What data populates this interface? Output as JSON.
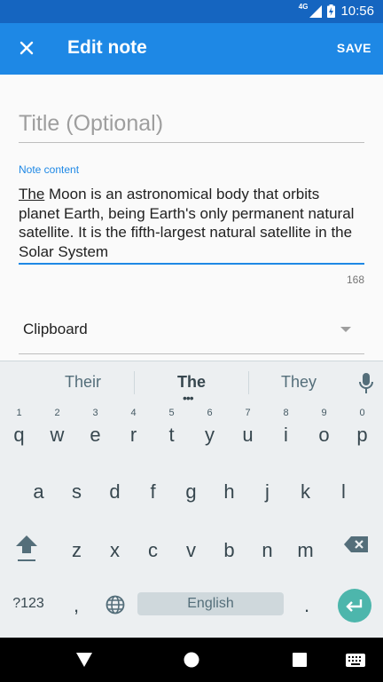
{
  "status_bar": {
    "network": "4G",
    "time": "10:56"
  },
  "app_bar": {
    "close_icon": "close-icon",
    "title": "Edit note",
    "save_label": "SAVE"
  },
  "form": {
    "title_placeholder": "Title (Optional)",
    "note_label": "Note content",
    "note_first_word": "The",
    "note_rest": " Moon is an astronomical body that orbits planet Earth, being Earth's only permanent natural satellite. It is the fifth-largest natural satellite in the Solar System",
    "char_count": "168",
    "category_value": "Clipboard"
  },
  "keyboard": {
    "suggestions": [
      "Their",
      "The",
      "They"
    ],
    "row1": [
      {
        "hint": "1",
        "ch": "q"
      },
      {
        "hint": "2",
        "ch": "w"
      },
      {
        "hint": "3",
        "ch": "e"
      },
      {
        "hint": "4",
        "ch": "r"
      },
      {
        "hint": "5",
        "ch": "t"
      },
      {
        "hint": "6",
        "ch": "y"
      },
      {
        "hint": "7",
        "ch": "u"
      },
      {
        "hint": "8",
        "ch": "i"
      },
      {
        "hint": "9",
        "ch": "o"
      },
      {
        "hint": "0",
        "ch": "p"
      }
    ],
    "row2": [
      "a",
      "s",
      "d",
      "f",
      "g",
      "h",
      "j",
      "k",
      "l"
    ],
    "row3": [
      "z",
      "x",
      "c",
      "v",
      "b",
      "n",
      "m"
    ],
    "symbols_label": "?123",
    "comma": ",",
    "space_label": "English",
    "period": "."
  },
  "colors": {
    "primary": "#1e88e5",
    "primary_dark": "#1565c0",
    "accent": "#4db6ac"
  }
}
